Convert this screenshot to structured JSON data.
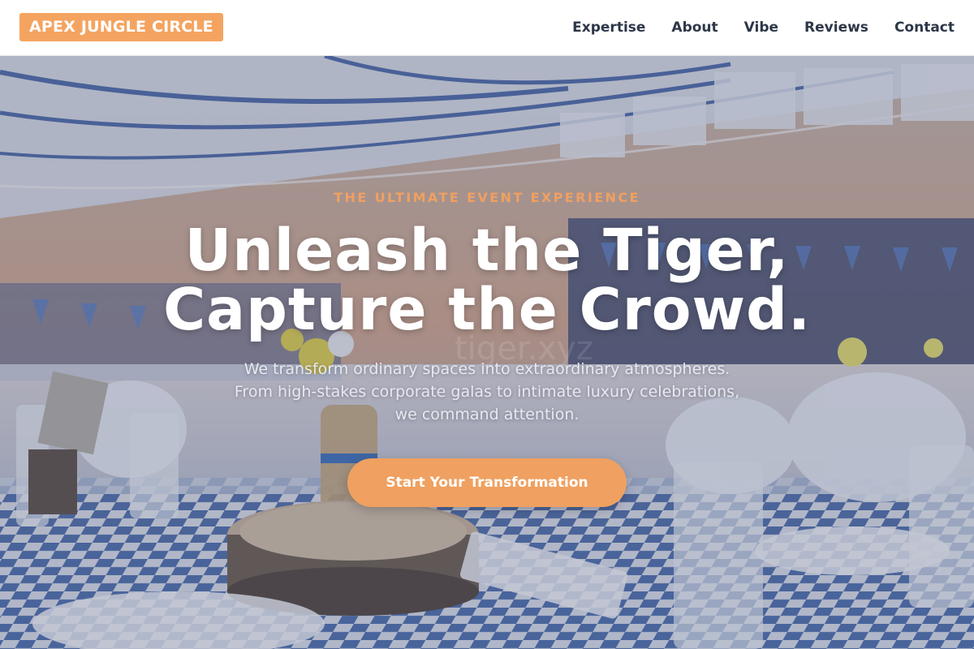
{
  "brand": {
    "logo_text": "APEX JUNGLE CIRCLE",
    "accent_color": "#f4a460"
  },
  "nav": {
    "links": [
      "Expertise",
      "About",
      "Vibe",
      "Reviews",
      "Contact"
    ]
  },
  "hero": {
    "eyebrow": "THE ULTIMATE EVENT EXPERIENCE",
    "headline_line1": "Unleash the Tiger,",
    "headline_line2": "Capture the Crowd.",
    "sub_line1": "We transform ordinary spaces into extraordinary atmospheres.",
    "sub_line2": "From high-stakes corporate galas to intimate luxury celebrations,",
    "sub_line3": "we command attention.",
    "cta_label": "Start Your Transformation",
    "watermark": "tiger.xyz",
    "image_description_icon": "event-banquet-hall-photo"
  }
}
